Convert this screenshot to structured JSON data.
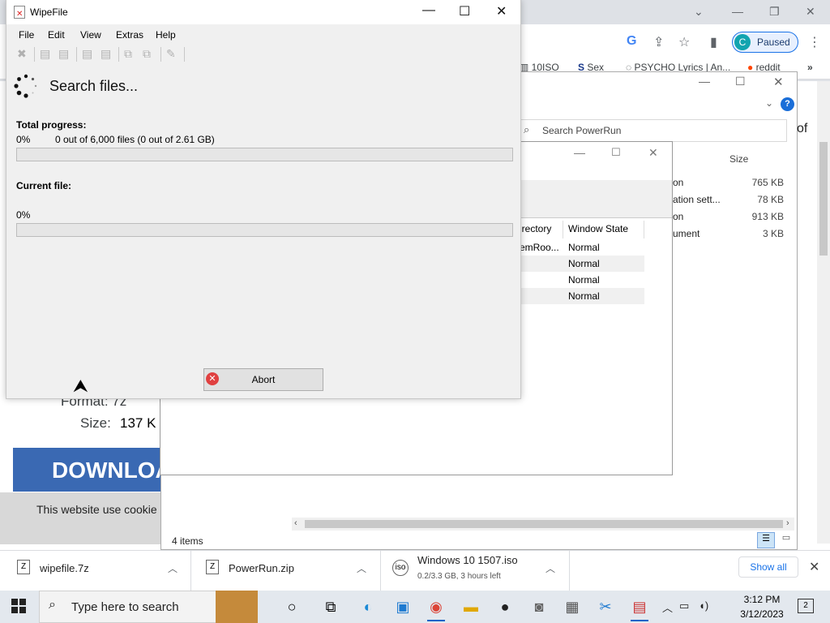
{
  "chrome": {
    "paused_avatar": "C",
    "paused_label": "Paused",
    "bookmarks": [
      "10ISO",
      "Sex",
      "PSYCHO Lyrics | An...",
      "reddit"
    ],
    "more": "»"
  },
  "web_page": {
    "format_text": "Format: 7z",
    "size_label": "Size:",
    "size_value": "137 K",
    "download_banner": "DOWNLOA",
    "cookie_text": "This website use cookie"
  },
  "explorer": {
    "search_placeholder": "Search PowerRun",
    "size_header": "Size",
    "items": [
      {
        "type_partial": "on",
        "size": "765 KB"
      },
      {
        "type_partial": "ation sett...",
        "size": "78 KB"
      },
      {
        "type_partial": "on",
        "size": "913 KB"
      },
      {
        "type_partial": "ument",
        "size": "3 KB"
      }
    ],
    "status": "4 items",
    "partial_text": "of"
  },
  "powerrun": {
    "col_directory": "irectory",
    "col_window_state": "Window State",
    "rows": [
      {
        "dir": "emRoo...",
        "state": "Normal"
      },
      {
        "dir": "",
        "state": "Normal"
      },
      {
        "dir": "",
        "state": "Normal"
      },
      {
        "dir": "",
        "state": "Normal"
      }
    ]
  },
  "wipefile": {
    "title": "WipeFile",
    "menu": [
      "File",
      "Edit",
      "View",
      "Extras",
      "Help"
    ],
    "heading": "Search files...",
    "total_progress_label": "Total progress:",
    "total_percent": "0%",
    "total_count": "0 out of 6,000 files (0 out of 2.61 GB)",
    "total_progress": 0,
    "current_file_label": "Current file:",
    "current_percent": "0%",
    "current_progress": 0,
    "abort_label": "Abort"
  },
  "downloads": {
    "items": [
      {
        "name": "wipefile.7z",
        "icon": "archive-icon"
      },
      {
        "name": "PowerRun.zip",
        "icon": "archive-icon"
      },
      {
        "name": "Windows 10 1507.iso",
        "status": "0.2/3.3 GB, 3 hours left",
        "icon": "iso-icon"
      }
    ],
    "show_all": "Show all"
  },
  "taskbar": {
    "search_placeholder": "Type here to search",
    "time": "3:12 PM",
    "date": "3/12/2023",
    "notification_count": "2"
  },
  "colors": {
    "download_banner": "#3a69b3",
    "paused_avatar": "#12a4af",
    "accent": "#1a73e8"
  }
}
